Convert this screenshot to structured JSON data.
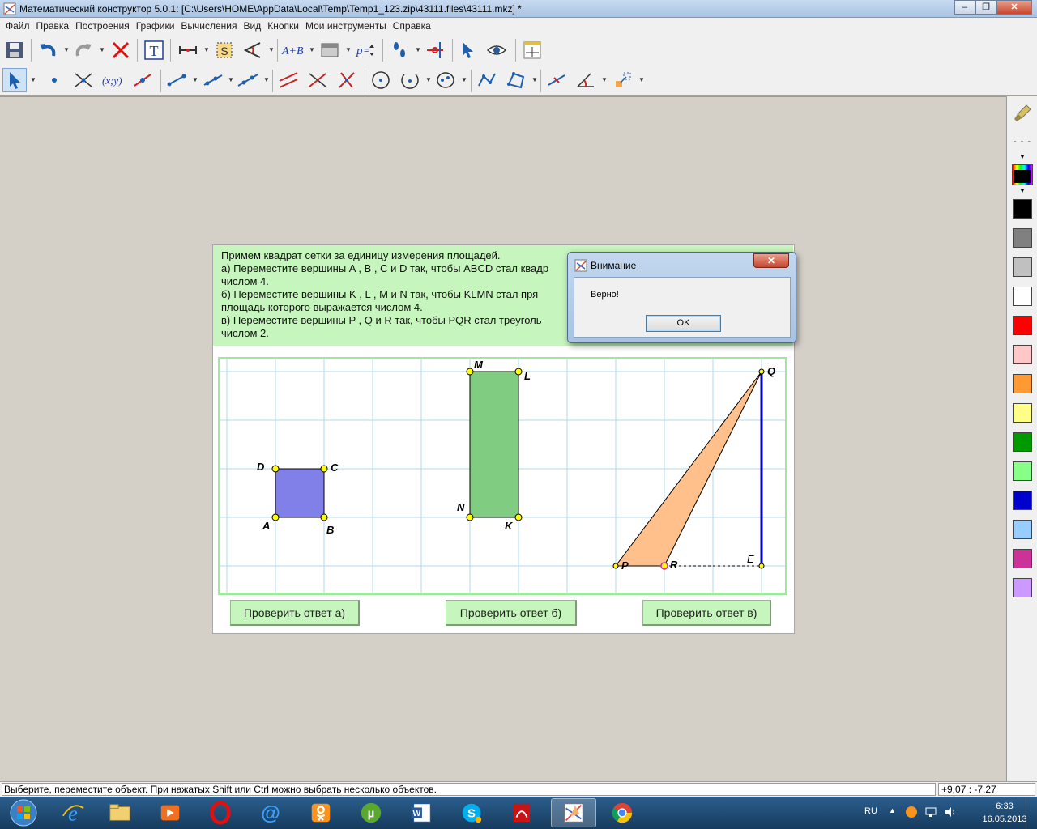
{
  "window": {
    "title": "Математический конструктор 5.0.1: [C:\\Users\\HOME\\AppData\\Local\\Temp\\Temp1_123.zip\\43111.files\\43111.mkz] *",
    "minimize": "–",
    "restore": "❐",
    "close": "✕"
  },
  "menu": [
    "Файл",
    "Правка",
    "Построения",
    "Графики",
    "Вычисления",
    "Вид",
    "Кнопки",
    "Мои инструменты",
    "Справка"
  ],
  "task": {
    "line1": "Примем квадрат сетки за единицу измерения площадей.",
    "line2": "а) Переместите вершины A , B , C и D так, чтобы ABCD стал квадр",
    "line3": "числом 4.",
    "line4": "б) Переместите вершины K , L , M и N так, чтобы KLMN стал пря",
    "line5": "площадь которого выражается числом 4.",
    "line6": "в) Переместите вершины P , Q и R так, чтобы PQR стал треуголь",
    "line7": "числом 2."
  },
  "points": {
    "A": "A",
    "B": "B",
    "C": "C",
    "D": "D",
    "K": "K",
    "L": "L",
    "M": "M",
    "N": "N",
    "P": "P",
    "Q": "Q",
    "R": "R",
    "E": "E"
  },
  "buttons": {
    "check_a": "Проверить ответ а)",
    "check_b": "Проверить ответ б)",
    "check_c": "Проверить ответ в)"
  },
  "dialog": {
    "title": "Внимание",
    "message": "Верно!",
    "ok": "OK",
    "close": "✕"
  },
  "status": {
    "hint": "Выберите, переместите объект. При нажатых Shift или Ctrl можно выбрать несколько объектов.",
    "coords": "+9,07 : -7,27"
  },
  "palette_colors": [
    "#000000",
    "#808080",
    "#c0c0c0",
    "#ffffff",
    "#ff0000",
    "#ffc8c8",
    "#ff9933",
    "#ffff88",
    "#009900",
    "#88ff88",
    "#0000cc",
    "#99ccff",
    "#cc3399",
    "#cc99ff"
  ],
  "colors": {
    "square": "#8080e8",
    "rectangle": "#80cc80",
    "triangle": "#ffc08c",
    "point": "#ffff00",
    "grid": "#b0d8f0",
    "grid_border": "#a0e8a0",
    "segment": "#0000cc"
  },
  "taskbar": {
    "lang": "RU",
    "time": "6:33",
    "date": "16.05.2013"
  }
}
